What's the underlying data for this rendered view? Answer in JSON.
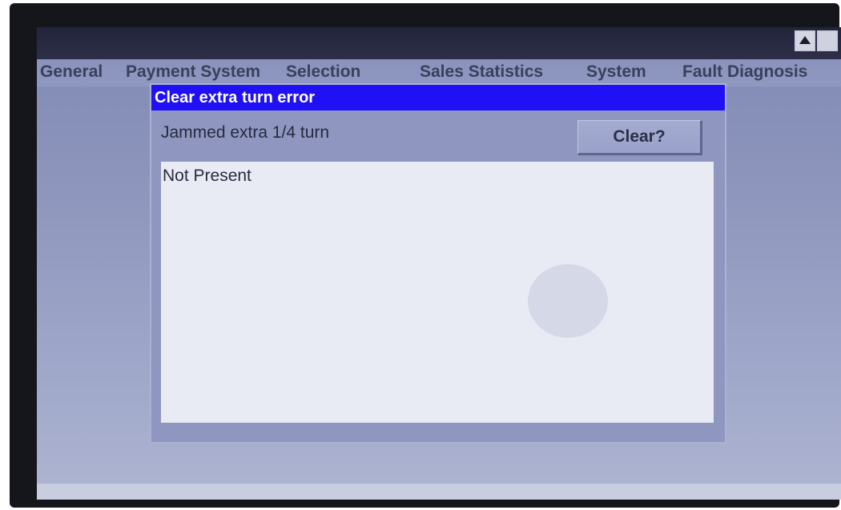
{
  "titlebar": {
    "buttons": [
      {
        "name": "scroll-up-button",
        "icon": "triangle-up-icon"
      },
      {
        "name": "window-square-button",
        "icon": "square-icon"
      }
    ]
  },
  "menu": {
    "items": [
      {
        "id": "general",
        "label": "General"
      },
      {
        "id": "payment",
        "label": "Payment System"
      },
      {
        "id": "selection",
        "label": "Selection"
      },
      {
        "id": "sales",
        "label": "Sales Statistics"
      },
      {
        "id": "system",
        "label": "System"
      },
      {
        "id": "fault",
        "label": "Fault Diagnosis"
      }
    ]
  },
  "dialog": {
    "title": "Clear extra turn error",
    "label": "Jammed extra 1/4 turn",
    "clear_button_label": "Clear?",
    "status_text": "Not Present",
    "title_color": "#1f10f5"
  }
}
